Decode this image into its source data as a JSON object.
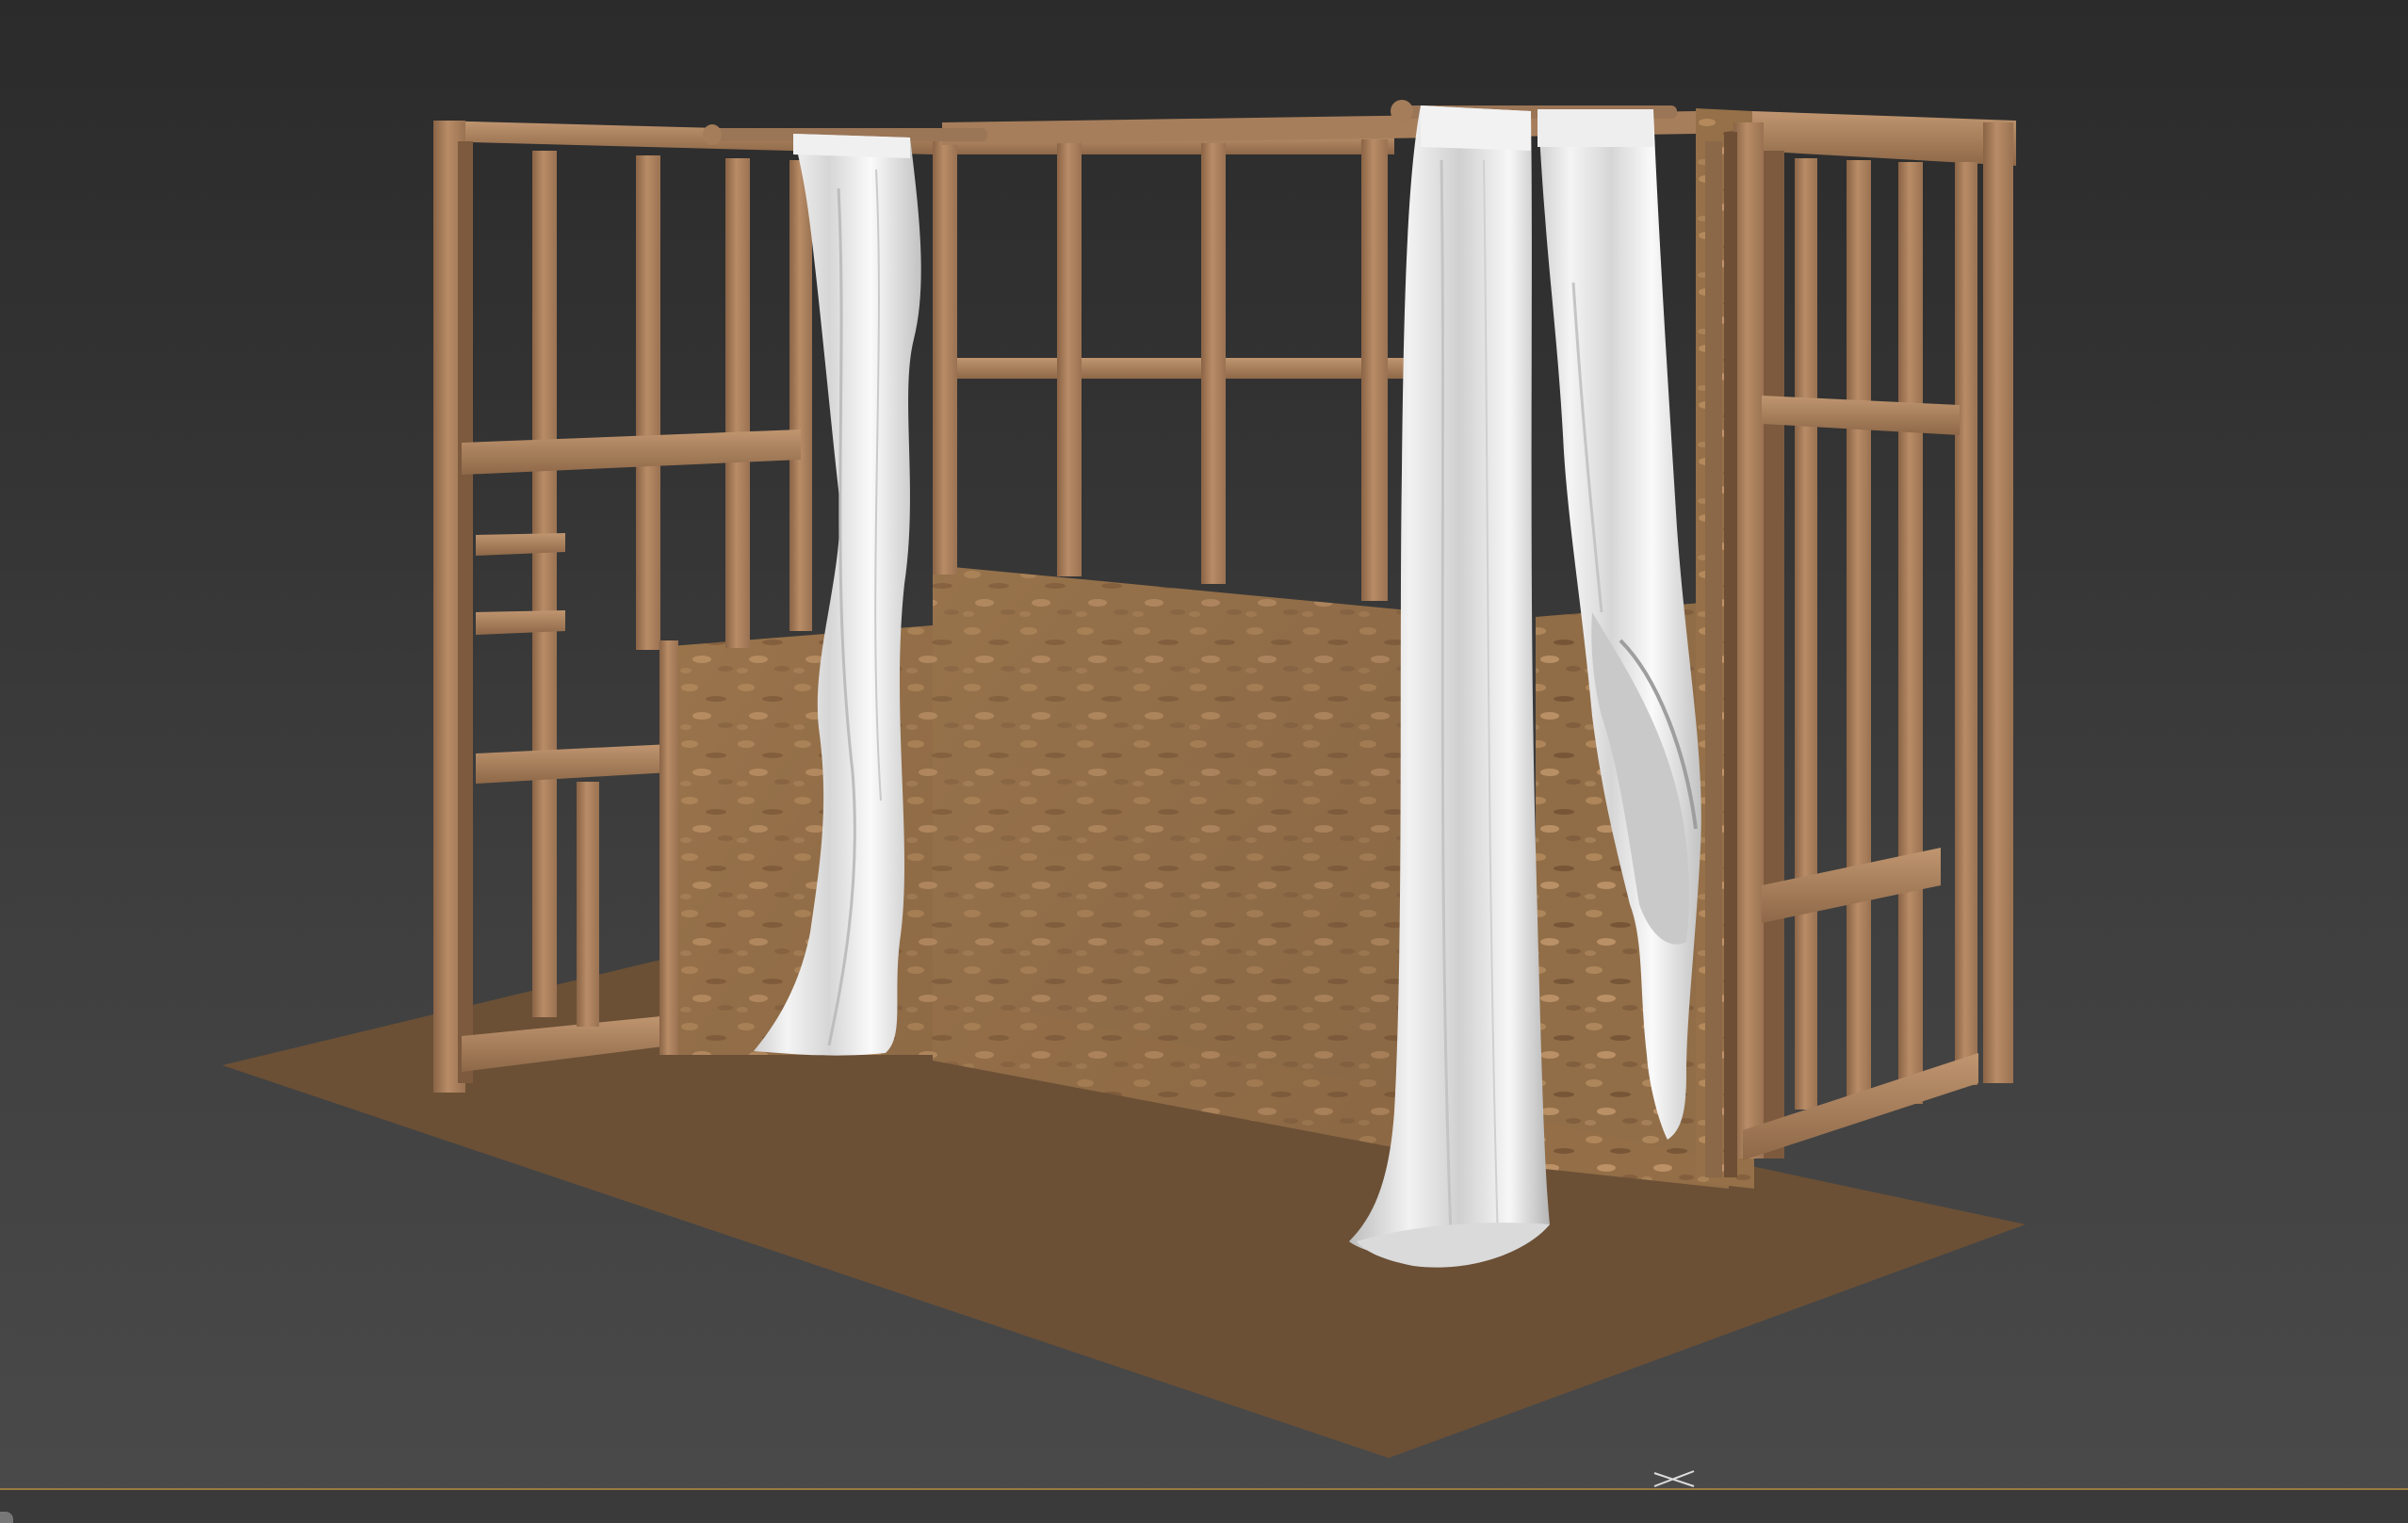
{
  "viewport": {
    "background_top": "#2b2b2b",
    "background_bottom": "#4a4a4a"
  },
  "scene": {
    "objects": [
      "floor-plane",
      "left-wall-frame",
      "back-wall-frame",
      "right-wall-frame",
      "osb-panels",
      "curtain-rod-left",
      "curtain-rod-right",
      "curtain-left",
      "curtain-center",
      "curtain-right"
    ],
    "colors": {
      "floor": "#6b5036",
      "wood_frame": "#b08460",
      "wood_frame_dark": "#8a6446",
      "osb": "#9a7650",
      "curtain": "#e8e8e8"
    }
  },
  "timeline": {
    "accent": "#9a7a42"
  },
  "gizmo": {
    "icon": "axis-cross-icon"
  }
}
